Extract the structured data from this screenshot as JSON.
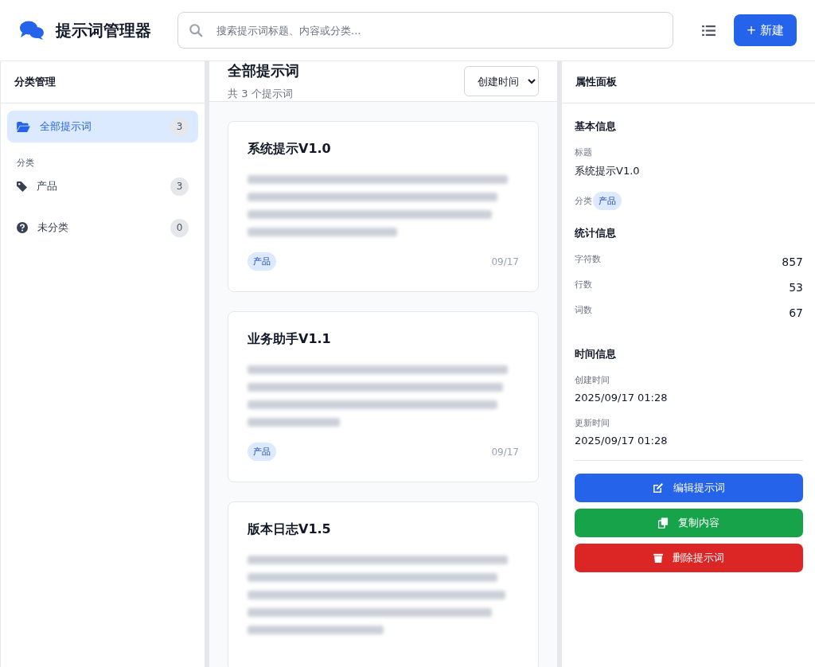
{
  "header": {
    "title": "提示词管理器",
    "search": {
      "placeholder": "搜索提示词标题、内容或分类..."
    },
    "new_button": "+ 新建"
  },
  "sidebar": {
    "title": "分类管理",
    "section_label": "分类",
    "items": [
      {
        "kind": "all",
        "label": "全部提示词",
        "count": "3",
        "selected": true
      },
      {
        "kind": "category",
        "label": "产品",
        "count": "3",
        "selected": false
      },
      {
        "kind": "uncategorized",
        "label": "未分类",
        "count": "0",
        "selected": false
      }
    ]
  },
  "list": {
    "title": "全部提示词",
    "subtitle": "共 3 个提示词",
    "sort": "创建时间",
    "cards": [
      {
        "title": "系统提示V1.0",
        "tag": "产品",
        "date": "09/17"
      },
      {
        "title": "业务助手V1.1",
        "tag": "产品",
        "date": "09/17"
      },
      {
        "title": "版本日志V1.5"
      }
    ]
  },
  "properties": {
    "title": "属性面板",
    "basic": {
      "heading": "基本信息",
      "title_label": "标题",
      "title_value": "系统提示V1.0",
      "category_label": "分类",
      "category_value": "产品"
    },
    "stats": {
      "heading": "统计信息",
      "rows": [
        {
          "label": "字符数",
          "value": "857"
        },
        {
          "label": "行数",
          "value": "53"
        },
        {
          "label": "词数",
          "value": "67"
        }
      ]
    },
    "time": {
      "heading": "时间信息",
      "rows": [
        {
          "label": "创建时间",
          "value": "2025/09/17 01:28"
        },
        {
          "label": "更新时间",
          "value": "2025/09/17 01:28"
        }
      ]
    },
    "actions": [
      {
        "kind": "edit",
        "label": "编辑提示词"
      },
      {
        "kind": "copy",
        "label": "复制内容"
      },
      {
        "kind": "delete",
        "label": "删除提示词"
      }
    ]
  }
}
